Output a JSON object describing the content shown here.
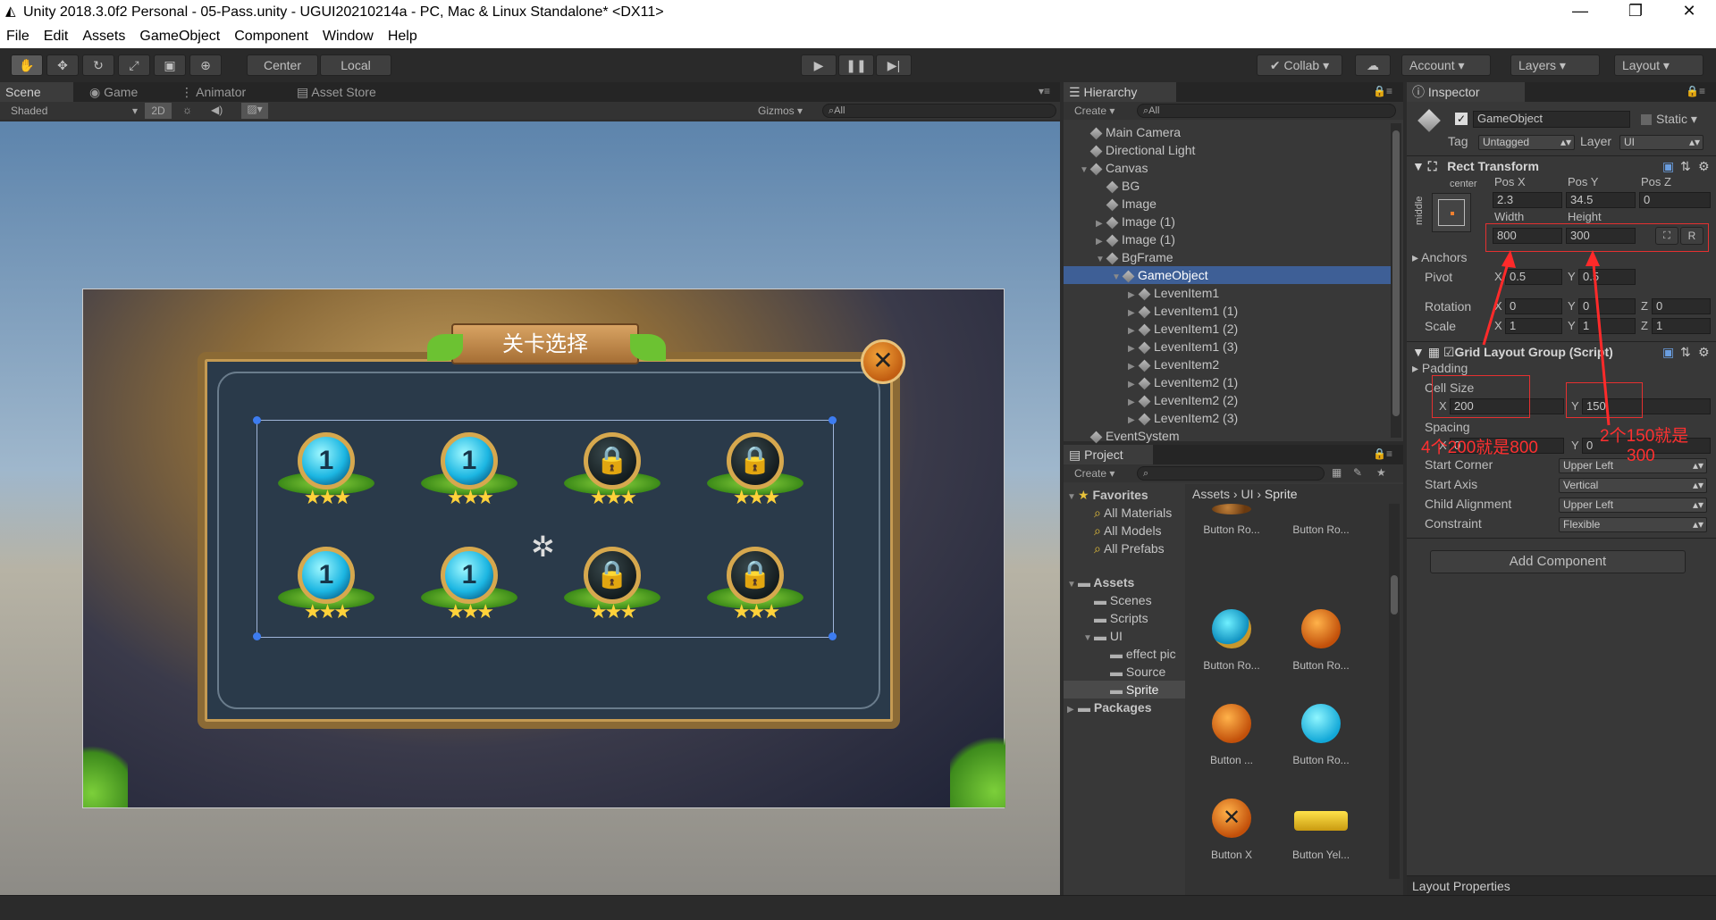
{
  "window": {
    "title": "Unity 2018.3.0f2 Personal - 05-Pass.unity - UGUI20210214a - PC, Mac & Linux Standalone* <DX11>"
  },
  "menu": [
    "File",
    "Edit",
    "Assets",
    "GameObject",
    "Component",
    "Window",
    "Help"
  ],
  "toolbar": {
    "center": "Center",
    "local": "Local",
    "collab": "Collab",
    "account": "Account",
    "layers": "Layers",
    "layout": "Layout"
  },
  "scene": {
    "tabs": [
      "Scene",
      "Game",
      "Animator",
      "Asset Store"
    ],
    "shading": "Shaded",
    "mode2d": "2D",
    "gizmos": "Gizmos",
    "search": "All",
    "banner": "关卡选择",
    "levels": [
      {
        "label": "1",
        "locked": false
      },
      {
        "label": "1",
        "locked": false
      },
      {
        "label": "",
        "locked": true
      },
      {
        "label": "",
        "locked": true
      },
      {
        "label": "1",
        "locked": false
      },
      {
        "label": "1",
        "locked": false
      },
      {
        "label": "",
        "locked": true
      },
      {
        "label": "",
        "locked": true
      }
    ]
  },
  "hierarchy": {
    "tab": "Hierarchy",
    "create": "Create",
    "search": "All",
    "items": [
      {
        "name": "Main Camera",
        "depth": 0,
        "arrow": ""
      },
      {
        "name": "Directional Light",
        "depth": 0,
        "arrow": ""
      },
      {
        "name": "Canvas",
        "depth": 0,
        "arrow": "open"
      },
      {
        "name": "BG",
        "depth": 1,
        "arrow": ""
      },
      {
        "name": "Image",
        "depth": 1,
        "arrow": ""
      },
      {
        "name": "Image (1)",
        "depth": 1,
        "arrow": "closed"
      },
      {
        "name": "Image (1)",
        "depth": 1,
        "arrow": "closed"
      },
      {
        "name": "BgFrame",
        "depth": 1,
        "arrow": "open"
      },
      {
        "name": "GameObject",
        "depth": 2,
        "arrow": "open",
        "selected": true
      },
      {
        "name": "LevenItem1",
        "depth": 3,
        "arrow": "closed"
      },
      {
        "name": "LevenItem1 (1)",
        "depth": 3,
        "arrow": "closed"
      },
      {
        "name": "LevenItem1 (2)",
        "depth": 3,
        "arrow": "closed"
      },
      {
        "name": "LevenItem1 (3)",
        "depth": 3,
        "arrow": "closed"
      },
      {
        "name": "LevenItem2",
        "depth": 3,
        "arrow": "closed"
      },
      {
        "name": "LevenItem2 (1)",
        "depth": 3,
        "arrow": "closed"
      },
      {
        "name": "LevenItem2 (2)",
        "depth": 3,
        "arrow": "closed"
      },
      {
        "name": "LevenItem2 (3)",
        "depth": 3,
        "arrow": "closed"
      },
      {
        "name": "EventSystem",
        "depth": 0,
        "arrow": ""
      }
    ]
  },
  "project": {
    "tab": "Project",
    "create": "Create",
    "breadcrumb": [
      "Assets",
      "UI",
      "Sprite"
    ],
    "favorites_label": "Favorites",
    "favorites": [
      "All Materials",
      "All Models",
      "All Prefabs"
    ],
    "tree": [
      {
        "name": "Assets",
        "depth": 0,
        "arrow": "open",
        "bold": true
      },
      {
        "name": "Scenes",
        "depth": 1,
        "arrow": ""
      },
      {
        "name": "Scripts",
        "depth": 1,
        "arrow": ""
      },
      {
        "name": "UI",
        "depth": 1,
        "arrow": "open"
      },
      {
        "name": "effect pic",
        "depth": 2,
        "arrow": ""
      },
      {
        "name": "Source",
        "depth": 2,
        "arrow": ""
      },
      {
        "name": "Sprite",
        "depth": 2,
        "arrow": "",
        "selected": true
      },
      {
        "name": "Packages",
        "depth": 0,
        "arrow": "closed",
        "bold": true
      }
    ],
    "assets": [
      "Button Ro...",
      "Button Ro...",
      "Button Ro...",
      "Button Ro...",
      "Button ...",
      "Button Ro...",
      "Button X",
      "Button Yel..."
    ]
  },
  "inspector": {
    "tab": "Inspector",
    "object_name": "GameObject",
    "static_label": "Static",
    "tag_label": "Tag",
    "tag_value": "Untagged",
    "layer_label": "Layer",
    "layer_value": "UI",
    "rect": {
      "title": "Rect Transform",
      "anchor_h": "center",
      "anchor_v": "middle",
      "posx_label": "Pos X",
      "posy_label": "Pos Y",
      "posz_label": "Pos Z",
      "posx": "2.3",
      "posy": "34.5",
      "posz": "0",
      "width_label": "Width",
      "height_label": "Height",
      "width": "800",
      "height": "300",
      "r_btn": "R",
      "anchors": "Anchors",
      "pivot": "Pivot",
      "pivot_x": "0.5",
      "pivot_y": "0.5",
      "rotation": "Rotation",
      "rot_x": "0",
      "rot_y": "0",
      "rot_z": "0",
      "scale": "Scale",
      "scale_x": "1",
      "scale_y": "1",
      "scale_z": "1",
      "x": "X",
      "y": "Y",
      "z": "Z"
    },
    "grid": {
      "title": "Grid Layout Group (Script)",
      "padding": "Padding",
      "cell_size": "Cell Size",
      "cell_x": "200",
      "cell_y": "150",
      "spacing": "Spacing",
      "spacing_x": "0",
      "spacing_y": "0",
      "start_corner": "Start Corner",
      "start_corner_value": "Upper Left",
      "start_axis": "Start Axis",
      "start_axis_value": "Vertical",
      "child_alignment": "Child Alignment",
      "child_alignment_value": "Upper Left",
      "constraint": "Constraint",
      "constraint_value": "Flexible"
    },
    "add_component": "Add Component",
    "layout_properties": "Layout Properties"
  },
  "annotations": {
    "note1": "4个200就是800",
    "note2_line1": "2个150就是",
    "note2_line2": "300"
  },
  "colors": {
    "selection": "#3e5f96",
    "annotation": "#ff2a2a"
  }
}
